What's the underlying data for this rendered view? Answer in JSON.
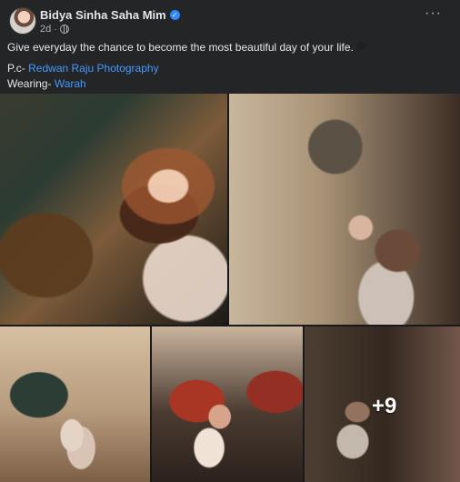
{
  "post": {
    "author": "Bidya Sinha Saha Mim",
    "timestamp": "2d",
    "separator": "·",
    "caption": "Give everyday the chance to become the most beautiful day of your life.",
    "credits": [
      {
        "label": "P.c-",
        "value": "Redwan Raju Photography"
      },
      {
        "label": "Wearing-",
        "value": "Warah"
      }
    ],
    "more_label": "···"
  },
  "photos": {
    "overflow_count": "+9"
  },
  "colors": {
    "background": "#242526",
    "link": "#4599ff",
    "verified": "#2d88ff"
  },
  "icons": [
    "verified-icon",
    "public-globe-icon",
    "more-options-icon",
    "heart-emoji-icon"
  ]
}
